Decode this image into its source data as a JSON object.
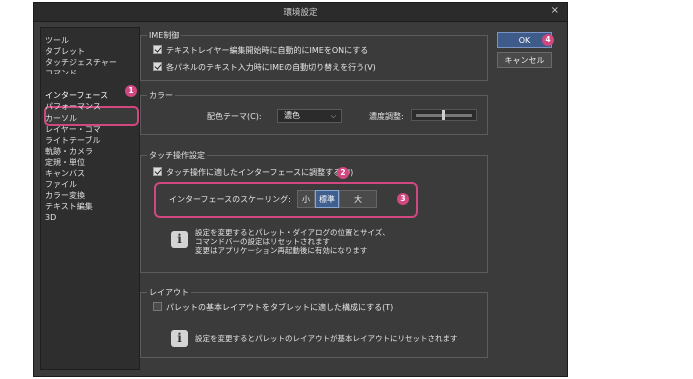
{
  "window": {
    "title": "環境設定",
    "close_glyph": "×"
  },
  "sidebar": {
    "items": [
      {
        "label": "ツール"
      },
      {
        "label": "タブレット"
      },
      {
        "label": "タッチジェスチャー"
      },
      {
        "label": "コマンド"
      },
      {
        "label": "インターフェース"
      },
      {
        "label": "パフォーマンス"
      },
      {
        "label": "カーソル"
      },
      {
        "label": "レイヤー・コマ"
      },
      {
        "label": "ライトテーブル"
      },
      {
        "label": "定規・単位"
      },
      {
        "label": "キャンバス"
      },
      {
        "label": "ファイル"
      },
      {
        "label": "カラー変換"
      },
      {
        "label": "テキスト編集"
      },
      {
        "label": "3D"
      }
    ],
    "selected": "インターフェース",
    "extra_item": "軌跡・カメラ"
  },
  "ime": {
    "label": "IME制御",
    "option1": "テキストレイヤー編集開始時に自動的にIMEをONにする",
    "option2": "各パネルのテキスト入力時にIMEの自動切り替えを行う(V)"
  },
  "color": {
    "label": "カラー",
    "theme_label": "配色テーマ(C):",
    "theme_value": "濃色",
    "density_label": "濃度調整:"
  },
  "touch": {
    "label": "タッチ操作設定",
    "adjust_label": "タッチ操作に適したインターフェースに調整する(U)",
    "scaling_label": "インターフェースのスケーリング:",
    "scaling_options": [
      "小",
      "標準",
      "大"
    ],
    "scaling_selected": "標準",
    "info_lines": [
      "設定を変更するとパレット・ダイアログの位置とサイズ、",
      "コマンドバーの設定はリセットされます",
      "変更はアプリケーション再起動後に有効になります"
    ]
  },
  "layout": {
    "label": "レイアウト",
    "tablet_label": "パレットの基本レイアウトをタブレットに適した構成にする(T)",
    "info_text": "設定を変更するとパレットのレイアウトが基本レイアウトにリセットされます"
  },
  "buttons": {
    "ok": "OK",
    "cancel": "キャンセル"
  },
  "badges": [
    "1",
    "2",
    "3",
    "4"
  ],
  "colors": {
    "highlight": "#d1477f",
    "ok_button": "#3e5b8a",
    "segment_active": "#3f5f8f"
  },
  "icons": {
    "info": "i"
  }
}
